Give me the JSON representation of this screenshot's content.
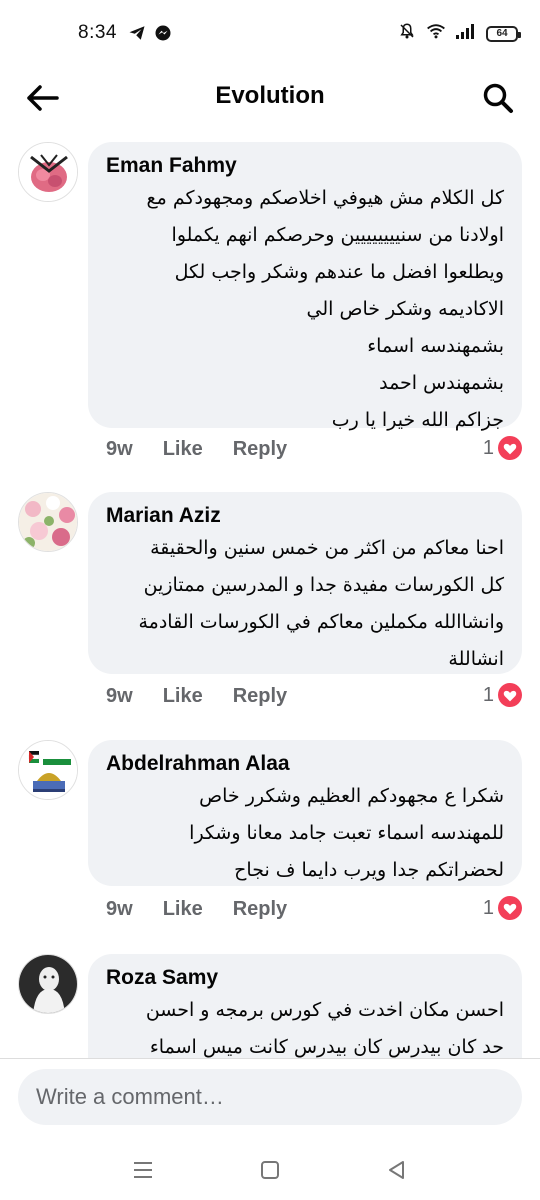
{
  "status_bar": {
    "time": "8:34",
    "battery": "64",
    "icons": [
      "telegram-icon",
      "messenger-icon",
      "mute-icon",
      "wifi-icon",
      "signal-icon",
      "battery-icon"
    ]
  },
  "header": {
    "title": "Evolution"
  },
  "comments": [
    {
      "author": "Eman Fahmy",
      "lines": [
        "كل الكلام مش هيوفي اخلاصكم ومجهودكم مع",
        "اولادنا من سنيييييييين وحرصكم انهم يكملوا",
        "ويطلعوا افضل ما عندهم وشكر واجب لكل",
        "الاكاديمه وشكر خاص الي",
        "بشمهندسه اسماء",
        "بشمهندس احمد",
        "جزاكم الله خيرا يا رب"
      ],
      "time": "9w",
      "like_label": "Like",
      "reply_label": "Reply",
      "reaction_count": "1"
    },
    {
      "author": "Marian Aziz",
      "lines": [
        "احنا معاكم من اكثر من خمس سنين والحقيقة",
        "كل الكورسات مفيدة جدا و المدرسين ممتازين",
        "وانشاالله مكملين معاكم في الكورسات القادمة",
        "انشاللة"
      ],
      "time": "9w",
      "like_label": "Like",
      "reply_label": "Reply",
      "reaction_count": "1"
    },
    {
      "author": "Abdelrahman Alaa",
      "lines": [
        "شكرا ع مجهودكم العظيم وشكرر خاص",
        "للمهندسه اسماء تعبت جامد معانا وشكرا",
        "لحضراتكم جدا ويرب دايما ف نجاح"
      ],
      "time": "9w",
      "like_label": "Like",
      "reply_label": "Reply",
      "reaction_count": "1"
    },
    {
      "author": "Roza Samy",
      "lines": [
        "احسن مكان اخدت في كورس برمجه و احسن",
        "حد كان بيدرس كان بيدرس كانت ميس اسماء"
      ]
    }
  ],
  "composer": {
    "placeholder": "Write a comment…"
  },
  "colors": {
    "bubble": "#f0f2f5",
    "secondary_text": "#65676b",
    "heart": "#f33e58"
  }
}
